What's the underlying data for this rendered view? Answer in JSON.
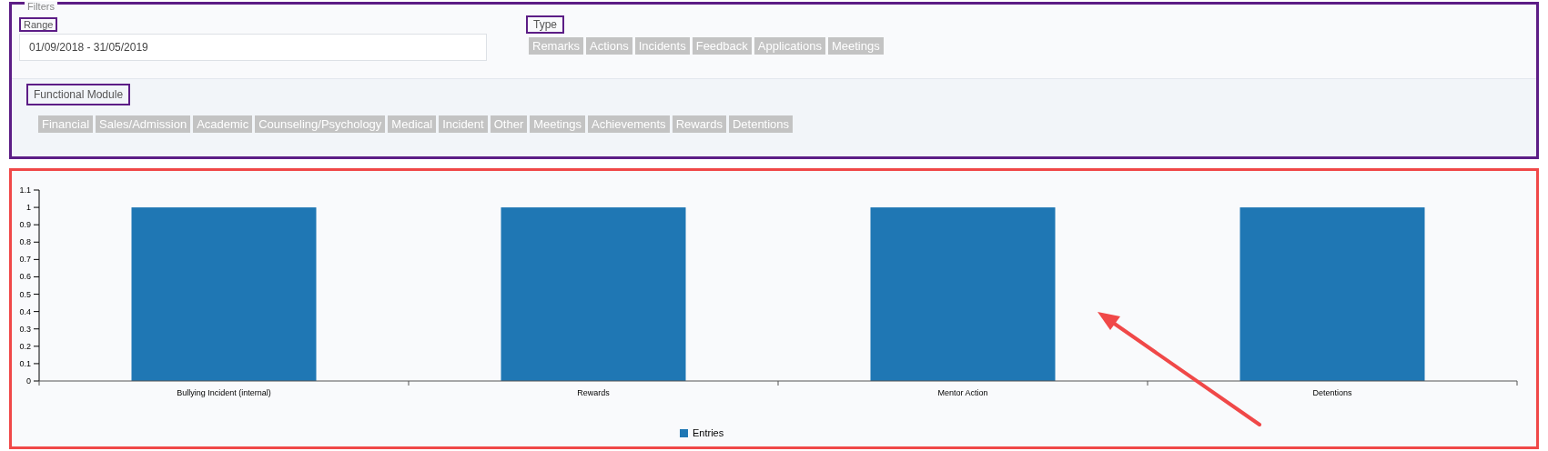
{
  "filters": {
    "legend": "Filters",
    "range": {
      "label": "Range",
      "value": "01/09/2018 - 31/05/2019"
    },
    "type": {
      "label": "Type",
      "tags": [
        "Remarks",
        "Actions",
        "Incidents",
        "Feedback",
        "Applications",
        "Meetings"
      ]
    },
    "functional_module": {
      "label": "Functional Module",
      "tags": [
        "Financial",
        "Sales/Admission",
        "Academic",
        "Counseling/Psychology",
        "Medical",
        "Incident",
        "Other",
        "Meetings",
        "Achievements",
        "Rewards",
        "Detentions"
      ]
    }
  },
  "chart": {
    "chart_data": {
      "type": "bar",
      "categories": [
        "Bullying Incident (internal)",
        "Rewards",
        "Mentor Action",
        "Detentions"
      ],
      "series": [
        {
          "name": "Entries",
          "color": "#1f77b4",
          "values": [
            1,
            1,
            1,
            1
          ]
        }
      ],
      "ylim": [
        0,
        1.1
      ],
      "yticks": [
        0,
        0.1,
        0.2,
        0.3,
        0.4,
        0.5,
        0.6,
        0.7,
        0.8,
        0.9,
        1,
        1.1
      ]
    }
  }
}
